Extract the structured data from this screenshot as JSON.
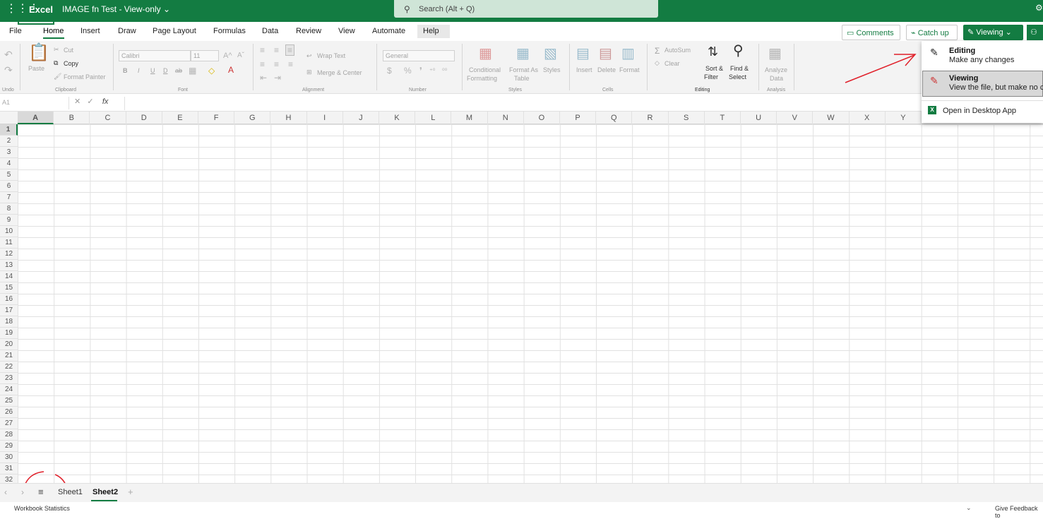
{
  "titlebar": {
    "app_name": "Excel",
    "doc_title": "IMAGE fn Test  -  View-only ⌄",
    "search_placeholder": "Search (Alt + Q)",
    "search_icon": "search-icon",
    "settings_icon": "gear-icon"
  },
  "tabs": [
    "File",
    "Home",
    "Insert",
    "Draw",
    "Page Layout",
    "Formulas",
    "Data",
    "Review",
    "View",
    "Automate",
    "Help"
  ],
  "active_tab": "Home",
  "top_buttons": {
    "comments": "Comments",
    "catch_up": "Catch up",
    "viewing": "Viewing"
  },
  "ribbon": {
    "undo_group": "Undo",
    "clipboard": {
      "paste": "Paste",
      "cut": "Cut",
      "copy": "Copy",
      "format_painter": "Format Painter",
      "label": "Clipboard"
    },
    "font": {
      "name": "Calibri",
      "size": "11",
      "bold": "B",
      "italic": "I",
      "underline": "U",
      "double_underline": "D",
      "strike": "ab",
      "label": "Font"
    },
    "alignment": {
      "wrap_text": "Wrap Text",
      "merge_center": "Merge & Center",
      "label": "Alignment"
    },
    "number": {
      "format": "General",
      "label": "Number"
    },
    "styles": {
      "conditional_1": "Conditional",
      "conditional_2": "Formatting",
      "format_as_table_1": "Format As",
      "format_as_table_2": "Table",
      "styles": "Styles",
      "label": "Styles"
    },
    "cells": {
      "insert": "Insert",
      "delete": "Delete",
      "format": "Format",
      "label": "Cells"
    },
    "editing": {
      "autosum": "AutoSum",
      "clear": "Clear",
      "sort_1": "Sort &",
      "sort_2": "Filter",
      "find_1": "Find &",
      "find_2": "Select",
      "label": "Editing"
    },
    "analysis": {
      "analyze_1": "Analyze",
      "analyze_2": "Data",
      "label": "Analysis"
    }
  },
  "formula_bar": {
    "name_box": "A1",
    "fx": "fx"
  },
  "columns": [
    "A",
    "B",
    "C",
    "D",
    "E",
    "F",
    "G",
    "H",
    "I",
    "J",
    "K",
    "L",
    "M",
    "N",
    "O",
    "P",
    "Q",
    "R",
    "S",
    "T",
    "U",
    "V",
    "W",
    "X",
    "Y"
  ],
  "rows": [
    "1",
    "2",
    "3",
    "4",
    "5",
    "6",
    "7",
    "8",
    "9",
    "10",
    "11",
    "12",
    "13",
    "14",
    "15",
    "16",
    "17",
    "18",
    "19",
    "20",
    "21",
    "22",
    "23",
    "24",
    "25",
    "26",
    "27",
    "28",
    "29",
    "30",
    "31",
    "32"
  ],
  "dropdown": {
    "editing_title": "Editing",
    "editing_desc": "Make any changes",
    "viewing_title": "Viewing",
    "viewing_desc": "View the file, but make no c",
    "open_desktop": "Open in Desktop App"
  },
  "sheets": [
    "Sheet1",
    "Sheet2"
  ],
  "active_sheet": "Sheet2",
  "status": {
    "workbook_stats": "Workbook Statistics",
    "feedback": "Give Feedback to"
  },
  "colors": {
    "brand": "#137c42",
    "annotation": "#e0202a"
  }
}
